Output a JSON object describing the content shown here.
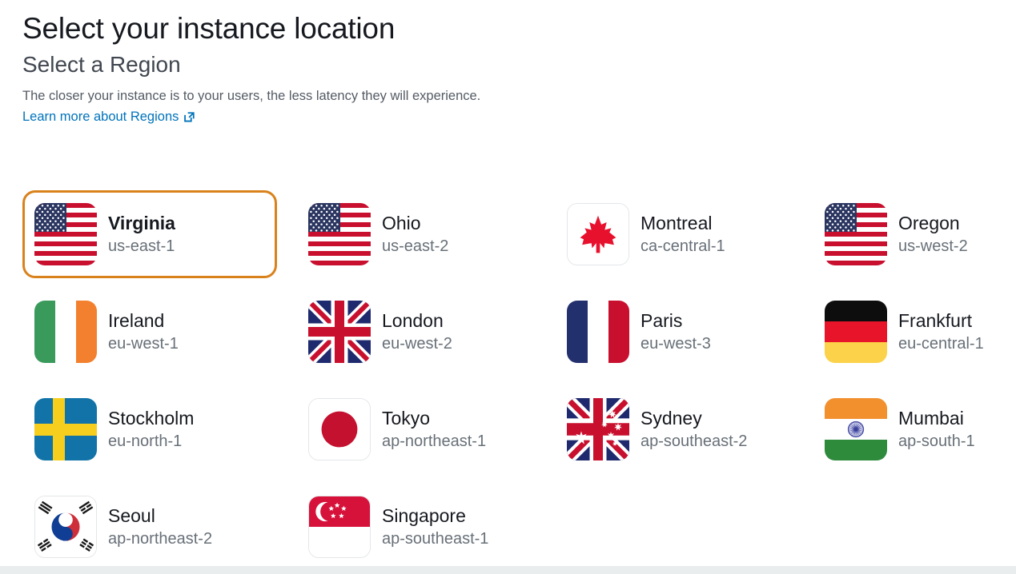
{
  "header": {
    "page_title": "Select your instance location",
    "section_title": "Select a Region",
    "description": "The closer your instance is to your users, the less latency they will experience.",
    "learn_more_label": "Learn more about Regions",
    "external_link_icon": "external-link-icon"
  },
  "colors": {
    "selected_border": "#d9821c",
    "link": "#0073bb",
    "title": "#16191f",
    "subtitle": "#414750",
    "muted_text": "#687078",
    "bottom_strip": "#eaeded"
  },
  "regions": [
    {
      "name": "Virginia",
      "code": "us-east-1",
      "flag": "us-flag-icon",
      "selected": true
    },
    {
      "name": "Ohio",
      "code": "us-east-2",
      "flag": "us-flag-icon",
      "selected": false
    },
    {
      "name": "Montreal",
      "code": "ca-central-1",
      "flag": "canada-flag-icon",
      "selected": false
    },
    {
      "name": "Oregon",
      "code": "us-west-2",
      "flag": "us-flag-icon",
      "selected": false
    },
    {
      "name": "Ireland",
      "code": "eu-west-1",
      "flag": "ireland-flag-icon",
      "selected": false
    },
    {
      "name": "London",
      "code": "eu-west-2",
      "flag": "uk-flag-icon",
      "selected": false
    },
    {
      "name": "Paris",
      "code": "eu-west-3",
      "flag": "france-flag-icon",
      "selected": false
    },
    {
      "name": "Frankfurt",
      "code": "eu-central-1",
      "flag": "germany-flag-icon",
      "selected": false
    },
    {
      "name": "Stockholm",
      "code": "eu-north-1",
      "flag": "sweden-flag-icon",
      "selected": false
    },
    {
      "name": "Tokyo",
      "code": "ap-northeast-1",
      "flag": "japan-flag-icon",
      "selected": false
    },
    {
      "name": "Sydney",
      "code": "ap-southeast-2",
      "flag": "australia-flag-icon",
      "selected": false
    },
    {
      "name": "Mumbai",
      "code": "ap-south-1",
      "flag": "india-flag-icon",
      "selected": false
    },
    {
      "name": "Seoul",
      "code": "ap-northeast-2",
      "flag": "southkorea-flag-icon",
      "selected": false
    },
    {
      "name": "Singapore",
      "code": "ap-southeast-1",
      "flag": "singapore-flag-icon",
      "selected": false
    }
  ]
}
